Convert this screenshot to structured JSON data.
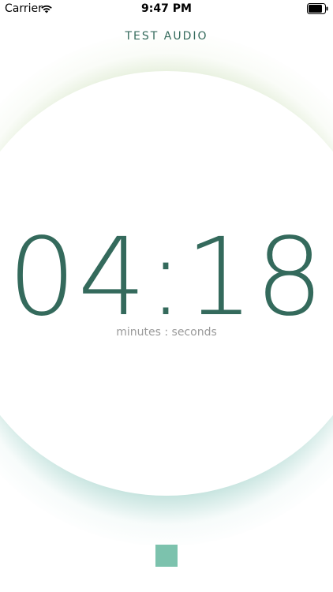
{
  "status_bar": {
    "carrier": "Carrier",
    "time": "9:47 PM",
    "wifi_icon": "wifi-icon",
    "battery_icon": "battery-icon"
  },
  "header": {
    "title": "TEST AUDIO"
  },
  "timer": {
    "value": "04:18",
    "label": "minutes : seconds"
  },
  "controls": {
    "stop_icon": "stop-icon"
  },
  "colors": {
    "accent": "#346a5c",
    "ring_top": "#aac88c",
    "ring_bottom": "#6eb9aa",
    "stop_button": "#7cc2ad",
    "label_gray": "#9a9a9a"
  }
}
